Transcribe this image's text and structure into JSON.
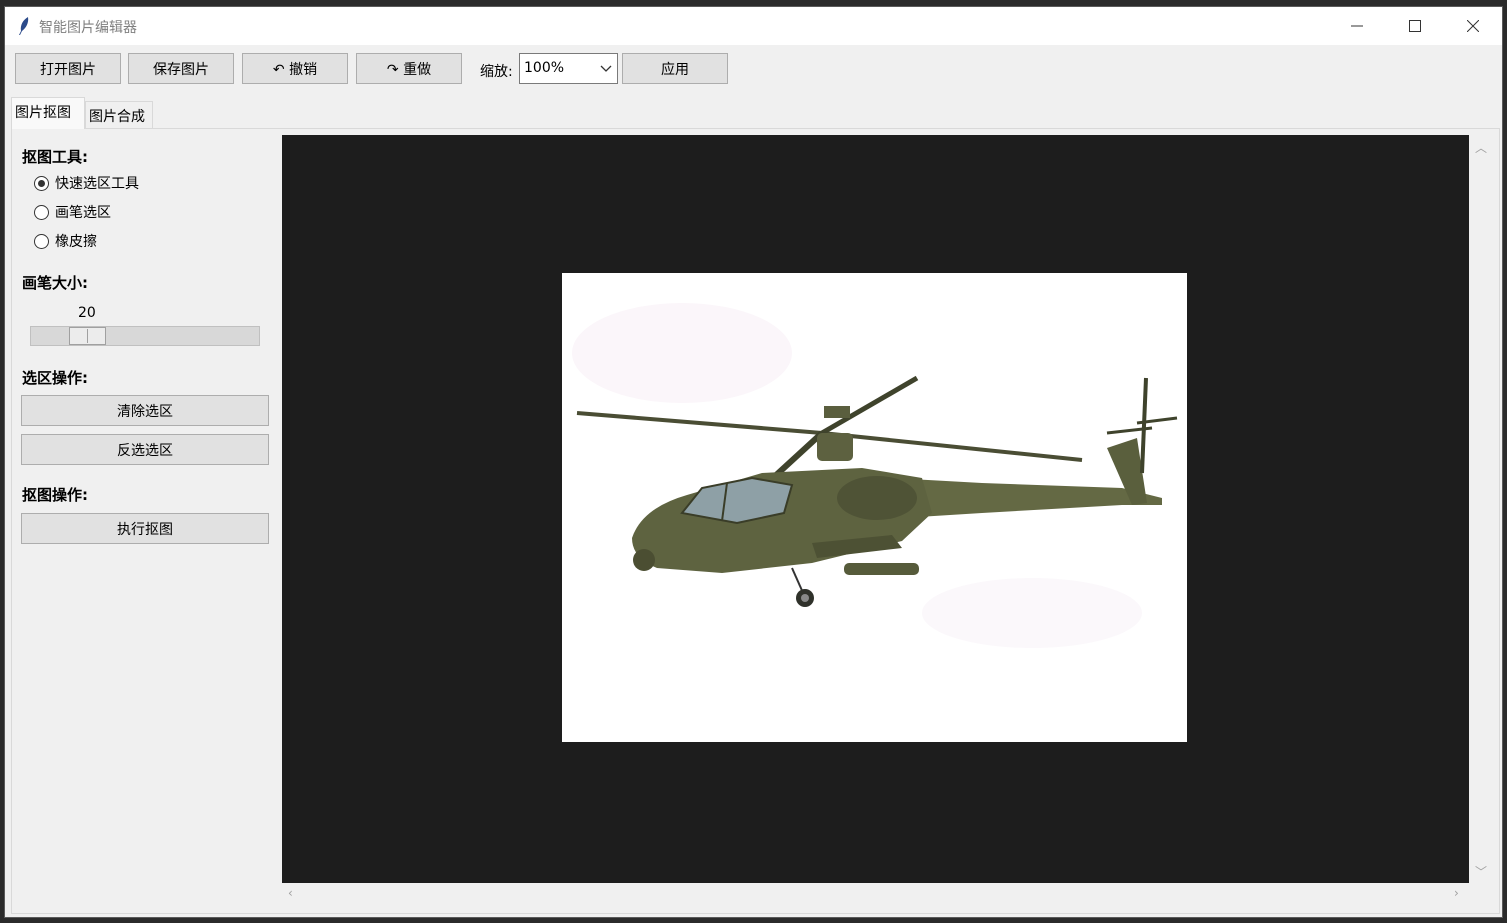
{
  "window": {
    "title": "智能图片编辑器",
    "controls": {
      "minimize": "—",
      "maximize": "☐",
      "close": "✕"
    }
  },
  "toolbar": {
    "open_label": "打开图片",
    "save_label": "保存图片",
    "undo_label": "↶ 撤销",
    "redo_label": "↷ 重做",
    "zoom_label": "缩放:",
    "zoom_value": "100%",
    "apply_label": "应用"
  },
  "tabs": [
    {
      "label": "图片抠图",
      "active": true
    },
    {
      "label": "图片合成",
      "active": false
    }
  ],
  "cutout_panel": {
    "tools_title": "抠图工具:",
    "tools": [
      {
        "label": "快速选区工具",
        "checked": true
      },
      {
        "label": "画笔选区",
        "checked": false
      },
      {
        "label": "橡皮擦",
        "checked": false
      }
    ],
    "brush_title": "画笔大小:",
    "brush_size": "20",
    "brush_slider_fraction": 0.2,
    "selection_title": "选区操作:",
    "clear_selection_label": "清除选区",
    "invert_selection_label": "反选选区",
    "cutout_title": "抠图操作:",
    "execute_cutout_label": "执行抠图"
  },
  "canvas": {
    "background": "#1d1d1d",
    "image_subject": "attack-helicopter-image"
  }
}
